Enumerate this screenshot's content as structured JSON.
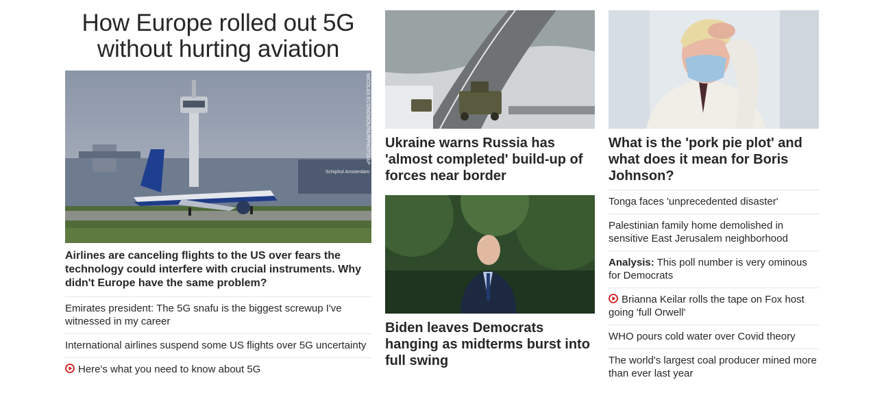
{
  "lead": {
    "title_line1": "How Europe rolled out 5G",
    "title_line2": "without hurting aviation",
    "image_credit": "NICOLAS ECONOMOU/NURPHOTO/AP",
    "image_sign": "Schiphol Amsterdam",
    "headline": "Airlines are canceling flights to the US over fears the technology could interfere with crucial instruments. Why didn't Europe have the same problem?",
    "links": [
      {
        "text": "Emirates president: The 5G snafu is the biggest screwup I've witnessed in my career",
        "video": false
      },
      {
        "text": "International airlines suspend some US flights over 5G uncertainty",
        "video": false
      },
      {
        "text": "Here's what you need to know about 5G",
        "video": true
      }
    ]
  },
  "middle": {
    "story1": {
      "headline": "Ukraine warns Russia has 'almost completed' build-up of forces near border"
    },
    "story2": {
      "headline": "Biden leaves Democrats hanging as midterms burst into full swing"
    }
  },
  "right": {
    "story": {
      "headline": "What is the 'pork pie plot' and what does it mean for Boris Johnson?"
    },
    "links": [
      {
        "prefix": "",
        "text": "Tonga faces 'unprecedented disaster'",
        "video": false
      },
      {
        "prefix": "",
        "text": "Palestinian family home demolished in sensitive East Jerusalem neighborhood",
        "video": false
      },
      {
        "prefix": "Analysis:",
        "text": " This poll number is very ominous for Democrats",
        "video": false
      },
      {
        "prefix": "",
        "text": "Brianna Keilar rolls the tape on Fox host going 'full Orwell'",
        "video": true
      },
      {
        "prefix": "",
        "text": "WHO pours cold water over Covid theory",
        "video": false
      },
      {
        "prefix": "",
        "text": "The world's largest coal producer mined more than ever last year",
        "video": false
      }
    ]
  },
  "colors": {
    "text": "#262626",
    "divider": "#e6e6e6",
    "video_icon": "#cc0000"
  }
}
